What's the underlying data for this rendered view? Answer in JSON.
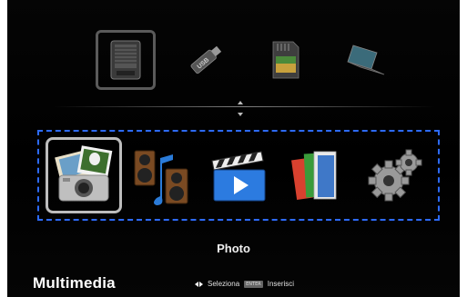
{
  "sources": [
    {
      "id": "internal",
      "icon": "hard-drive-icon",
      "selected": true
    },
    {
      "id": "usb",
      "icon": "usb-stick-icon",
      "label": "USB",
      "selected": false
    },
    {
      "id": "sd",
      "icon": "sd-card-icon",
      "selected": false
    },
    {
      "id": "network",
      "icon": "laptop-network-icon",
      "selected": false
    }
  ],
  "apps": [
    {
      "id": "photo",
      "icon": "photo-icon",
      "selected": true
    },
    {
      "id": "music",
      "icon": "music-icon",
      "selected": false
    },
    {
      "id": "video",
      "icon": "video-icon",
      "selected": false
    },
    {
      "id": "office",
      "icon": "office-docs-icon",
      "selected": false
    },
    {
      "id": "settings",
      "icon": "gear-icon",
      "selected": false
    }
  ],
  "selected_label": "Photo",
  "footer": {
    "title": "Multimedia",
    "hint_select": "Seleziona",
    "enter_key": "ENTER",
    "hint_insert": "Inserisci"
  },
  "colors": {
    "tray_border": "#2d6bff",
    "selection_border": "#bdbdbd",
    "background": "#000000"
  }
}
